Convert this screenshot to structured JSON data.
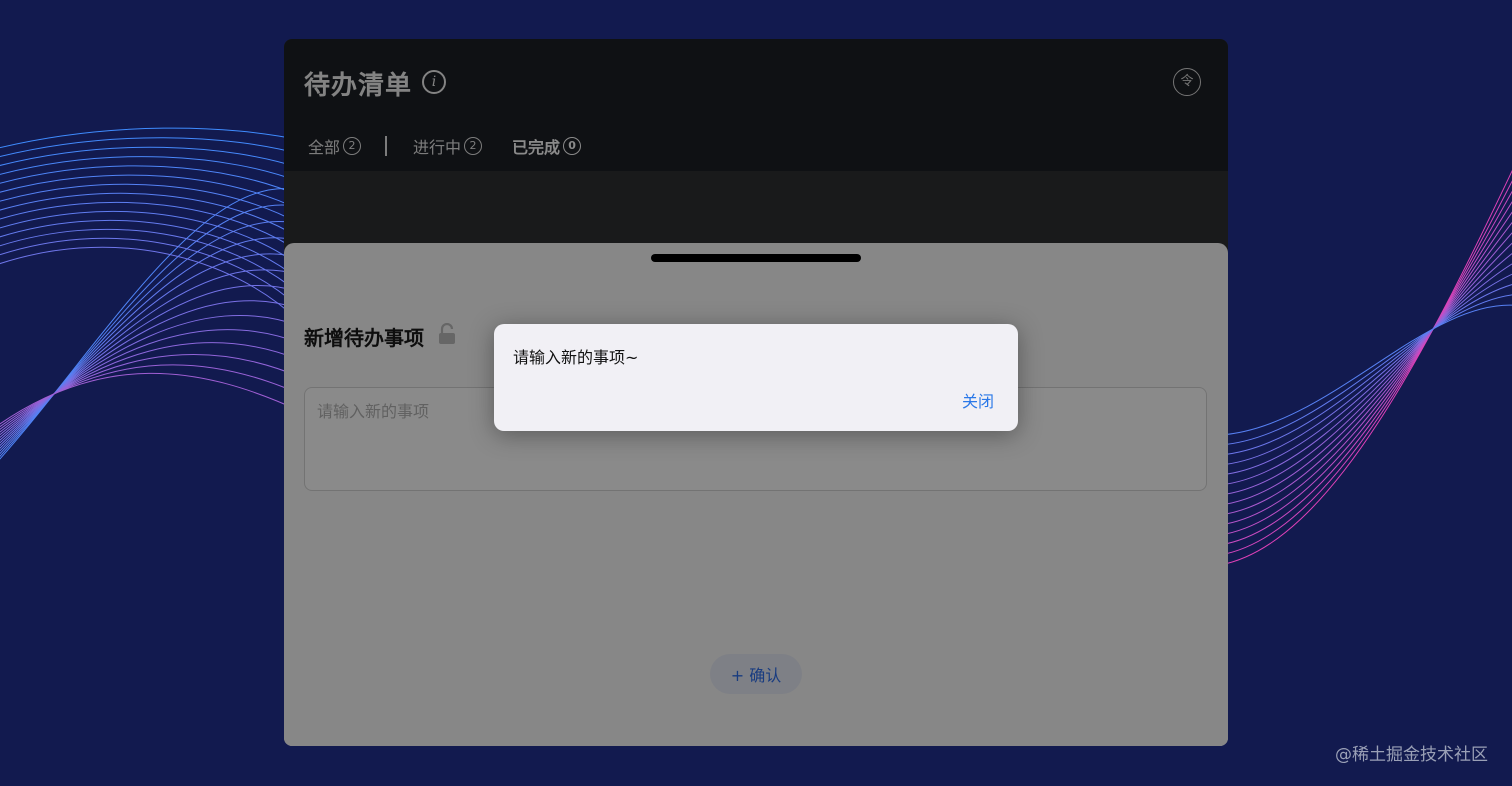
{
  "app": {
    "title": "待办清单",
    "info_icon_glyph": "i",
    "top_right_icon_glyph": "令"
  },
  "tabs": [
    {
      "label": "全部",
      "count": "2"
    },
    {
      "label": "进行中",
      "count": "2"
    },
    {
      "label": "已完成",
      "count": "0"
    }
  ],
  "sheet": {
    "title": "新增待办事项",
    "input_placeholder": "请输入新的事项",
    "confirm_label": "+ 确认"
  },
  "dialog": {
    "message": "请输入新的事项~",
    "close_label": "关闭"
  },
  "watermark": "@稀土掘金技术社区",
  "colors": {
    "background": "#121a4f",
    "accent": "#2f6fed",
    "wave_left": "#3f8cff",
    "wave_right": "#e041b8"
  }
}
